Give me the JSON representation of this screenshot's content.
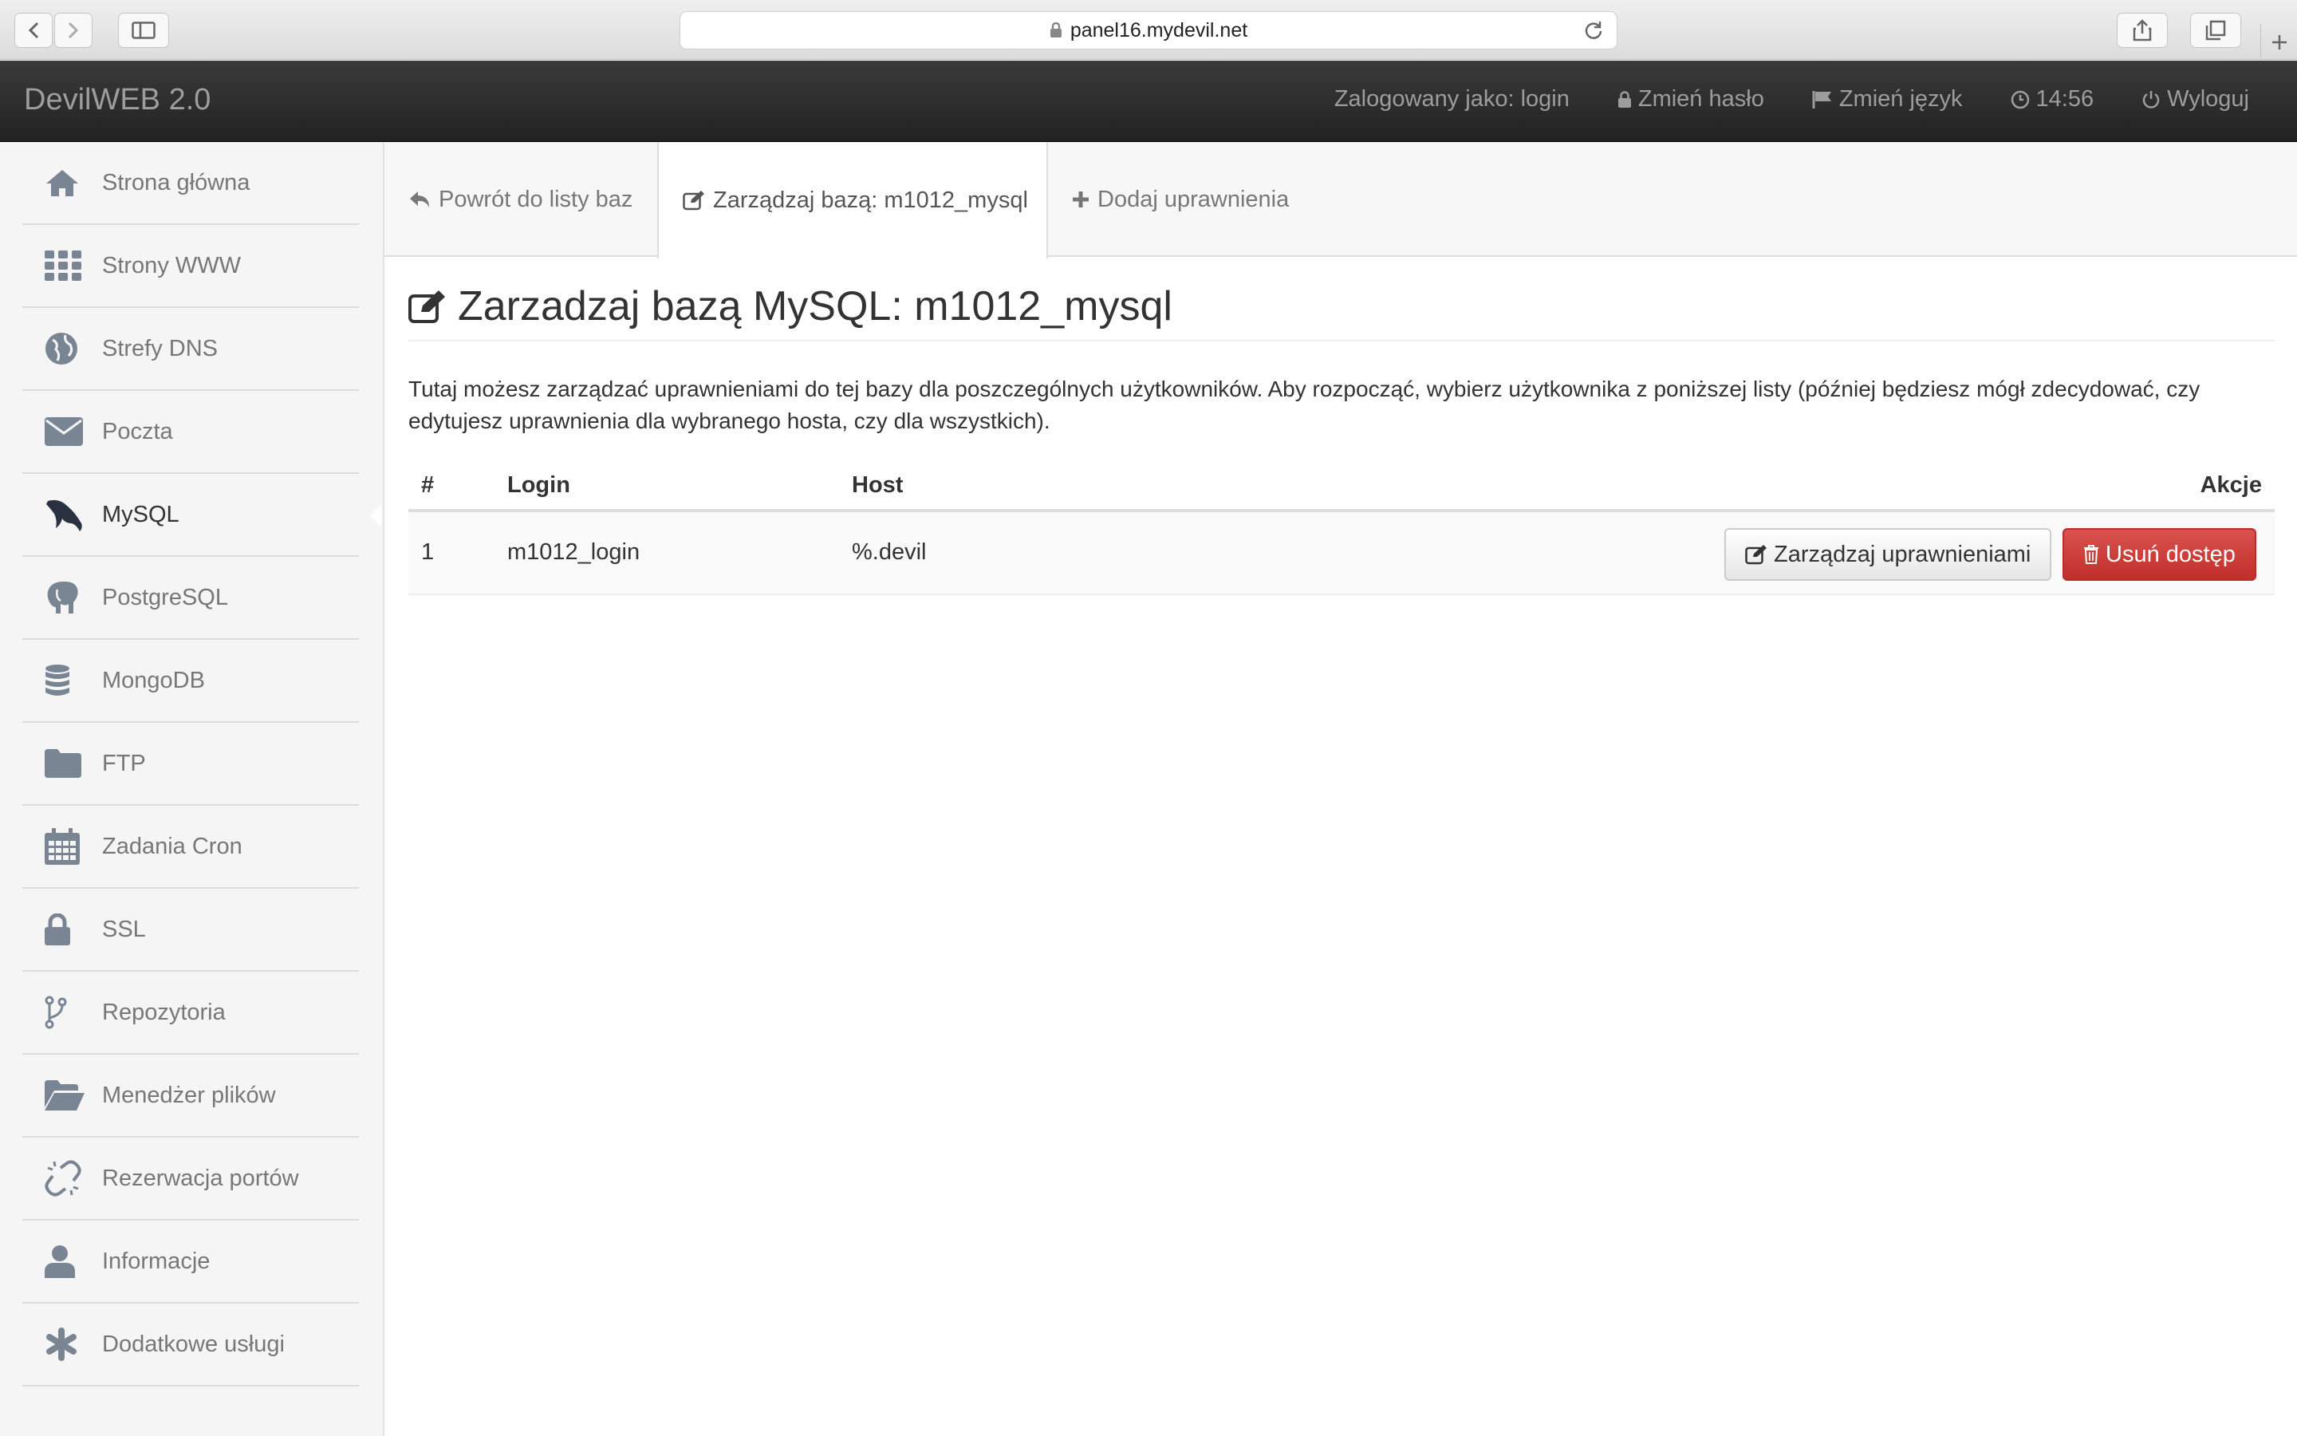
{
  "browser": {
    "url": "panel16.mydevil.net"
  },
  "navbar": {
    "brand": "DevilWEB 2.0",
    "logged_in": "Zalogowany jako: login",
    "change_password": "Zmień hasło",
    "change_language": "Zmień język",
    "time": "14:56",
    "logout": "Wyloguj"
  },
  "sidebar": {
    "items": [
      {
        "label": "Strona główna",
        "icon": "home-icon"
      },
      {
        "label": "Strony WWW",
        "icon": "grid-icon"
      },
      {
        "label": "Strefy DNS",
        "icon": "globe-icon"
      },
      {
        "label": "Poczta",
        "icon": "envelope-icon"
      },
      {
        "label": "MySQL",
        "icon": "dolphin-icon",
        "active": true
      },
      {
        "label": "PostgreSQL",
        "icon": "elephant-icon"
      },
      {
        "label": "MongoDB",
        "icon": "database-icon"
      },
      {
        "label": "FTP",
        "icon": "folder-icon"
      },
      {
        "label": "Zadania Cron",
        "icon": "calendar-icon"
      },
      {
        "label": "SSL",
        "icon": "lock-icon"
      },
      {
        "label": "Repozytoria",
        "icon": "branch-icon"
      },
      {
        "label": "Menedżer plików",
        "icon": "folder-open-icon"
      },
      {
        "label": "Rezerwacja portów",
        "icon": "unlink-icon"
      },
      {
        "label": "Informacje",
        "icon": "user-icon"
      },
      {
        "label": "Dodatkowe usługi",
        "icon": "asterisk-icon"
      }
    ]
  },
  "tabs": {
    "back": "Powrót do listy baz",
    "manage": "Zarządzaj bazą: m1012_mysql",
    "add": "Dodaj uprawnienia"
  },
  "main": {
    "title": "Zarzadzaj bazą MySQL: m1012_mysql",
    "description": "Tutaj możesz zarządzać uprawnieniami do tej bazy dla poszczególnych użytkowników. Aby rozpocząć, wybierz użytkownika z poniższej listy (później będziesz mógł zdecydować, czy edytujesz uprawnienia dla wybranego hosta, czy dla wszystkich).",
    "table": {
      "headers": {
        "num": "#",
        "login": "Login",
        "host": "Host",
        "actions": "Akcje"
      },
      "rows": [
        {
          "num": "1",
          "login": "m1012_login",
          "host": "%.devil"
        }
      ],
      "manage_button": "Zarządzaj uprawnieniami",
      "delete_button": "Usuń dostęp"
    }
  },
  "colors": {
    "navbar": "#222222",
    "danger": "#d9534f",
    "sidebar_icon": "#7a8593"
  }
}
